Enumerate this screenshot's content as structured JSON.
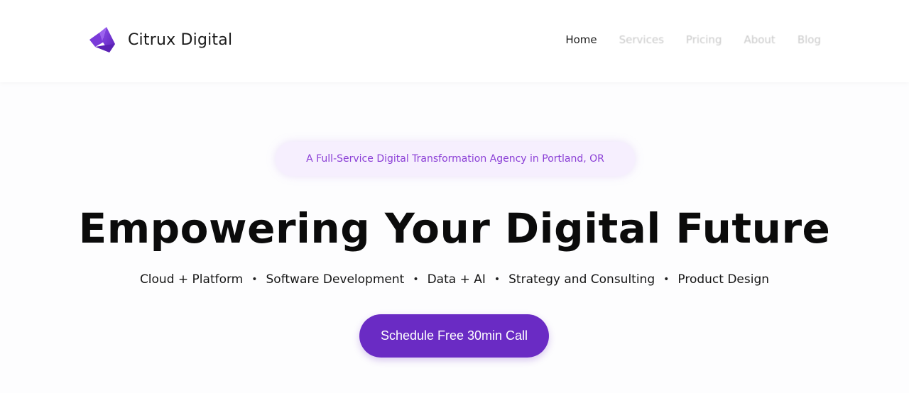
{
  "header": {
    "brand_name": "Citrux Digital",
    "logo_icon": "citrux-triangle-logo",
    "nav": [
      {
        "label": "Home",
        "active": true
      },
      {
        "label": "Services",
        "active": false
      },
      {
        "label": "Pricing",
        "active": false
      },
      {
        "label": "About",
        "active": false
      },
      {
        "label": "Blog",
        "active": false
      }
    ]
  },
  "hero": {
    "tagline": "A Full-Service Digital Transformation Agency in Portland, OR",
    "title": "Empowering Your Digital Future",
    "services": [
      "Cloud + Platform",
      "Software Development",
      "Data + AI",
      "Strategy and Consulting",
      "Product Design"
    ],
    "separator": "•",
    "cta_label": "Schedule Free 30min Call"
  },
  "colors": {
    "accent": "#6a2bc4",
    "tagline_text": "#8b3fd6",
    "tagline_bg": "#f6effe",
    "nav_inactive": "#c9c9c9",
    "nav_active": "#1a1a1a"
  }
}
